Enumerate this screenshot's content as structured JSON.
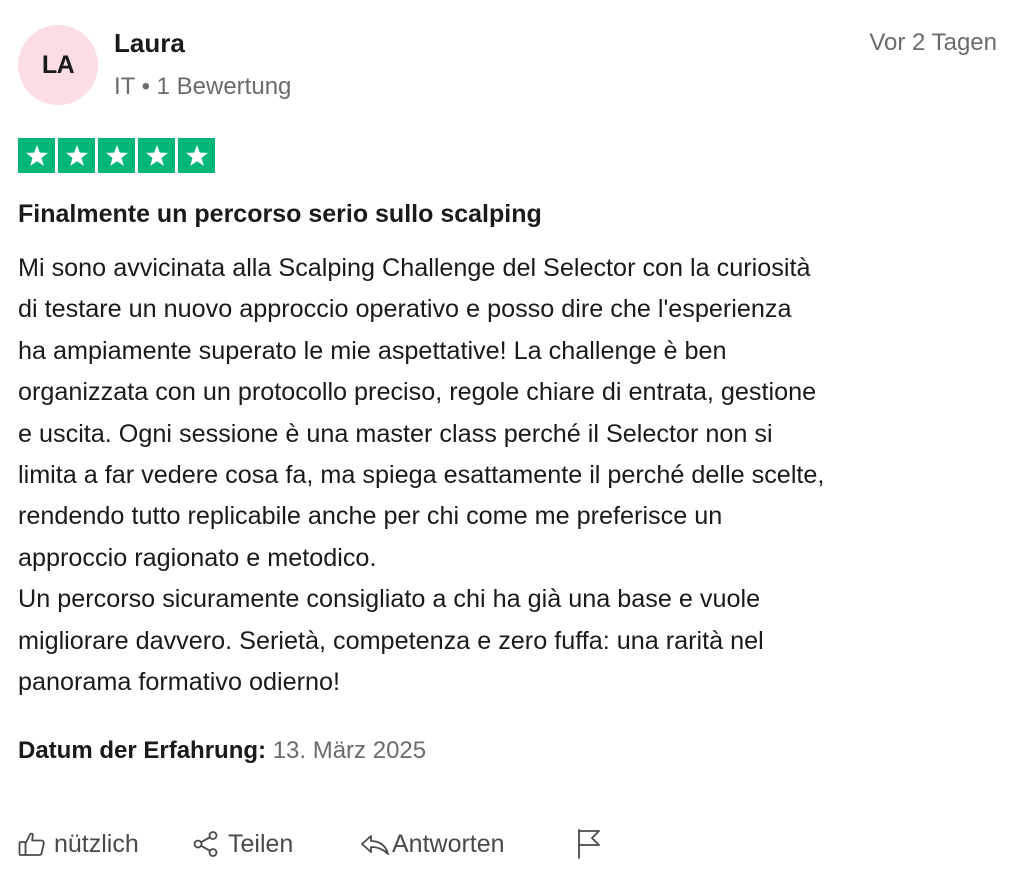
{
  "reviewer": {
    "initials": "LA",
    "name": "Laura",
    "meta": "IT • 1 Bewertung"
  },
  "posted": "Vor 2 Tagen",
  "rating": {
    "value": 5,
    "max": 5,
    "color": "#00b67a"
  },
  "review": {
    "title": "Finalmente un percorso serio sullo scalping",
    "lines": [
      "Mi sono avvicinata alla Scalping Challenge del Selector con la curiosità",
      "di testare un nuovo approccio operativo e posso dire che l'esperienza",
      "ha ampiamente superato le mie aspettative! La challenge è ben",
      "organizzata con un protocollo preciso, regole chiare di entrata, gestione",
      "e uscita. Ogni sessione è una master class perché il Selector non si",
      "limita a far vedere cosa fa, ma spiega esattamente il perché delle scelte,",
      "rendendo tutto replicabile anche per chi come me preferisce un",
      "approccio ragionato e metodico.",
      "Un percorso sicuramente consigliato a chi ha già una base e vuole",
      "migliorare davvero. Serietà, competenza e zero fuffa: una rarità nel",
      "panorama formativo odierno!"
    ]
  },
  "experience": {
    "label": "Datum der Erfahrung:",
    "date": "13. März 2025"
  },
  "actions": {
    "useful": "nützlich",
    "share": "Teilen",
    "reply": "Antworten"
  },
  "icons": {
    "useful": "thumbs-up-icon",
    "share": "share-icon",
    "reply": "reply-arrow-icon",
    "report": "flag-icon",
    "star": "star-icon"
  }
}
